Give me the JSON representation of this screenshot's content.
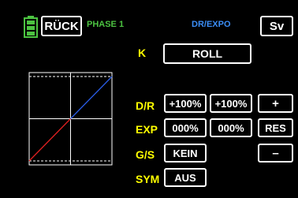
{
  "header": {
    "back_label": "RÜCK",
    "phase_label": "PHASE 1",
    "title": "DR/EXPO",
    "save_label": "Sv"
  },
  "channel": {
    "label": "K",
    "value": "ROLL"
  },
  "rows": {
    "dr": {
      "label": "D/R",
      "left": "+100%",
      "right": "+100%"
    },
    "exp": {
      "label": "EXP",
      "left": "000%",
      "right": "000%"
    },
    "gs": {
      "label": "G/S",
      "value": "KEIN"
    },
    "sym": {
      "label": "SYM",
      "value": "AUS"
    }
  },
  "side_buttons": {
    "plus": "+",
    "res": "RES",
    "minus": "–"
  },
  "graph": {
    "input_range": [
      -100,
      100
    ],
    "output_range": [
      -100,
      100
    ],
    "limit_high": 100,
    "limit_low": -100,
    "curve_negative_color": "#e02020",
    "curve_positive_color": "#2a5de8"
  },
  "colors": {
    "background": "#000000",
    "label": "#ffff00",
    "phase": "#4cc341",
    "title": "#3b8df5",
    "battery": "#4cc341"
  }
}
